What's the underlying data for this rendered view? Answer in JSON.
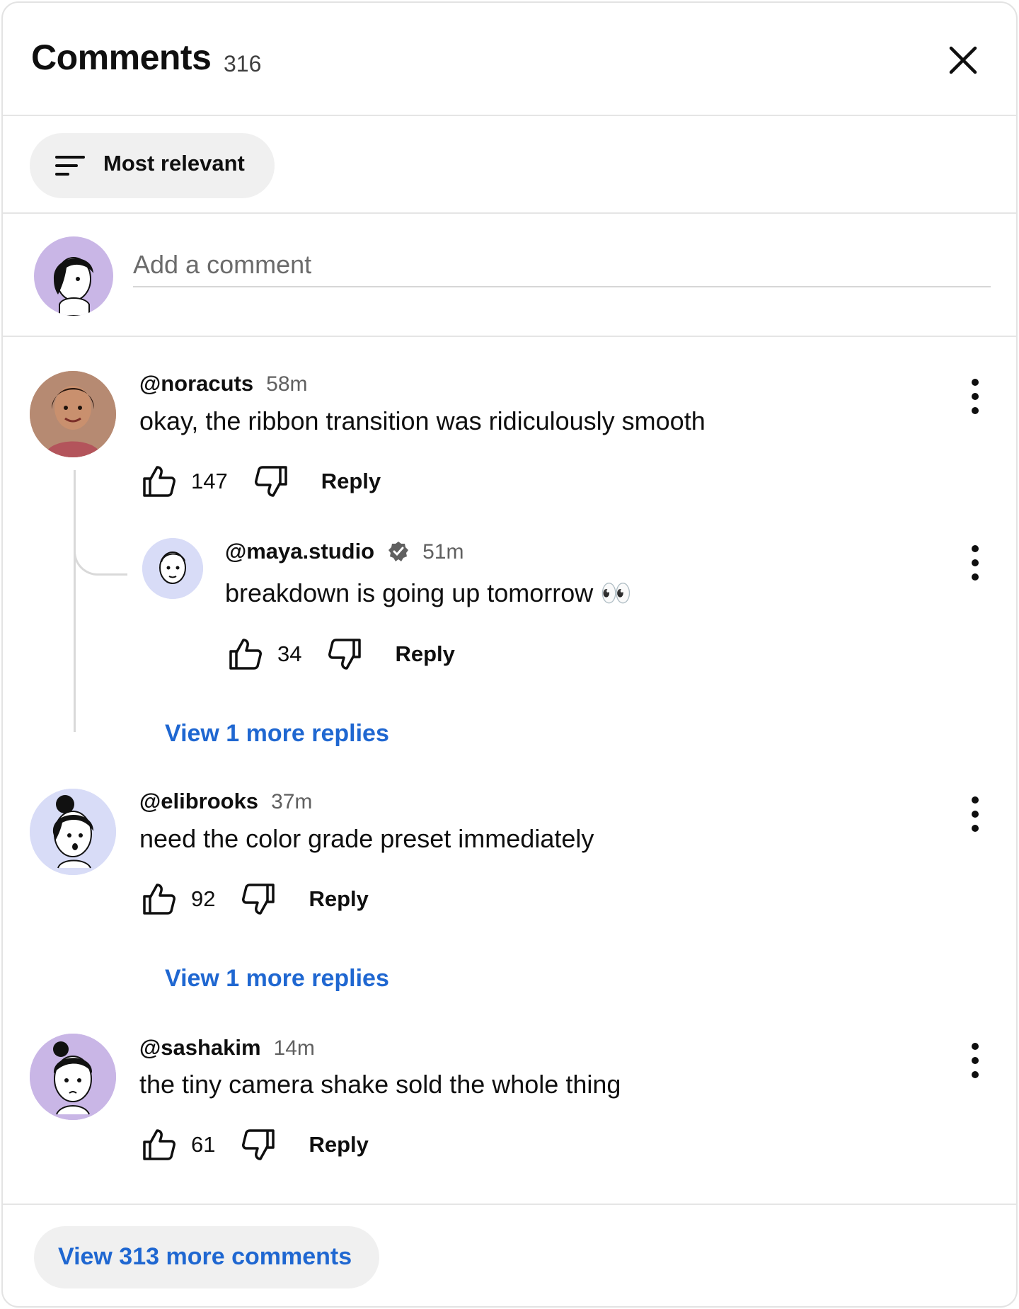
{
  "header": {
    "title": "Comments",
    "count": "316",
    "close_icon": "close-icon"
  },
  "sort": {
    "label": "Most relevant",
    "icon": "sort-icon"
  },
  "composer": {
    "placeholder": "Add a comment"
  },
  "comments": [
    {
      "handle": "@noracuts",
      "time": "58m",
      "text": "okay, the ribbon transition was ridiculously smooth",
      "likes": "147",
      "reply_label": "Reply",
      "replies": [
        {
          "handle": "@maya.studio",
          "verified": true,
          "time": "51m",
          "text": "breakdown is going up tomorrow 👀",
          "likes": "34",
          "reply_label": "Reply"
        }
      ],
      "view_more": "View 1 more replies"
    },
    {
      "handle": "@elibrooks",
      "time": "37m",
      "text": "need the color grade preset immediately",
      "likes": "92",
      "reply_label": "Reply",
      "view_more": "View 1 more replies"
    },
    {
      "handle": "@sashakim",
      "time": "14m",
      "text": "the tiny camera shake sold the whole thing",
      "likes": "61",
      "reply_label": "Reply"
    }
  ],
  "footer": {
    "more_comments": "View 313 more comments"
  },
  "colors": {
    "link": "#1f67d1",
    "avatar_purple": "#c9b6e6",
    "avatar_lavender": "#d8dcf7"
  }
}
